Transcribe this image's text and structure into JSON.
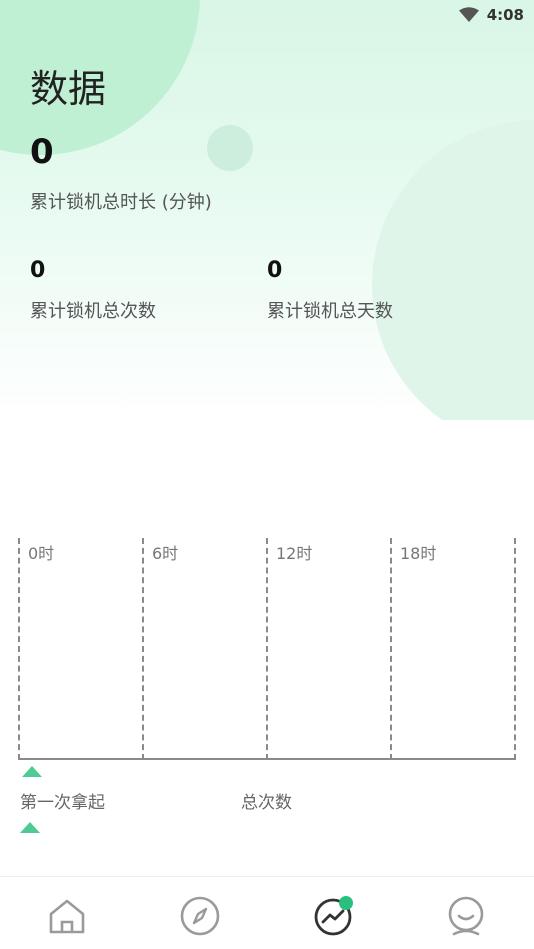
{
  "status_bar": {
    "time": "4:08",
    "wifi_icon": "wifi-icon"
  },
  "header": {
    "title": "数据"
  },
  "stats": {
    "total_duration": {
      "value": "0",
      "label": "累计锁机总时长 (分钟)"
    },
    "total_count": {
      "value": "0",
      "label": "累计锁机总次数"
    },
    "total_days": {
      "value": "0",
      "label": "累计锁机总天数"
    }
  },
  "timeline": {
    "hours": [
      "0时",
      "6时",
      "12时",
      "18时"
    ]
  },
  "legend": {
    "first_pickup": "第一次拿起",
    "total_times": "总次数",
    "marker_color": "#4ecb95"
  },
  "nav": {
    "items": [
      {
        "icon": "home-icon",
        "active": false
      },
      {
        "icon": "compass-icon",
        "active": false
      },
      {
        "icon": "chart-icon",
        "active": true
      },
      {
        "icon": "profile-icon",
        "active": false
      }
    ],
    "active_color": "#2bbf7f"
  }
}
